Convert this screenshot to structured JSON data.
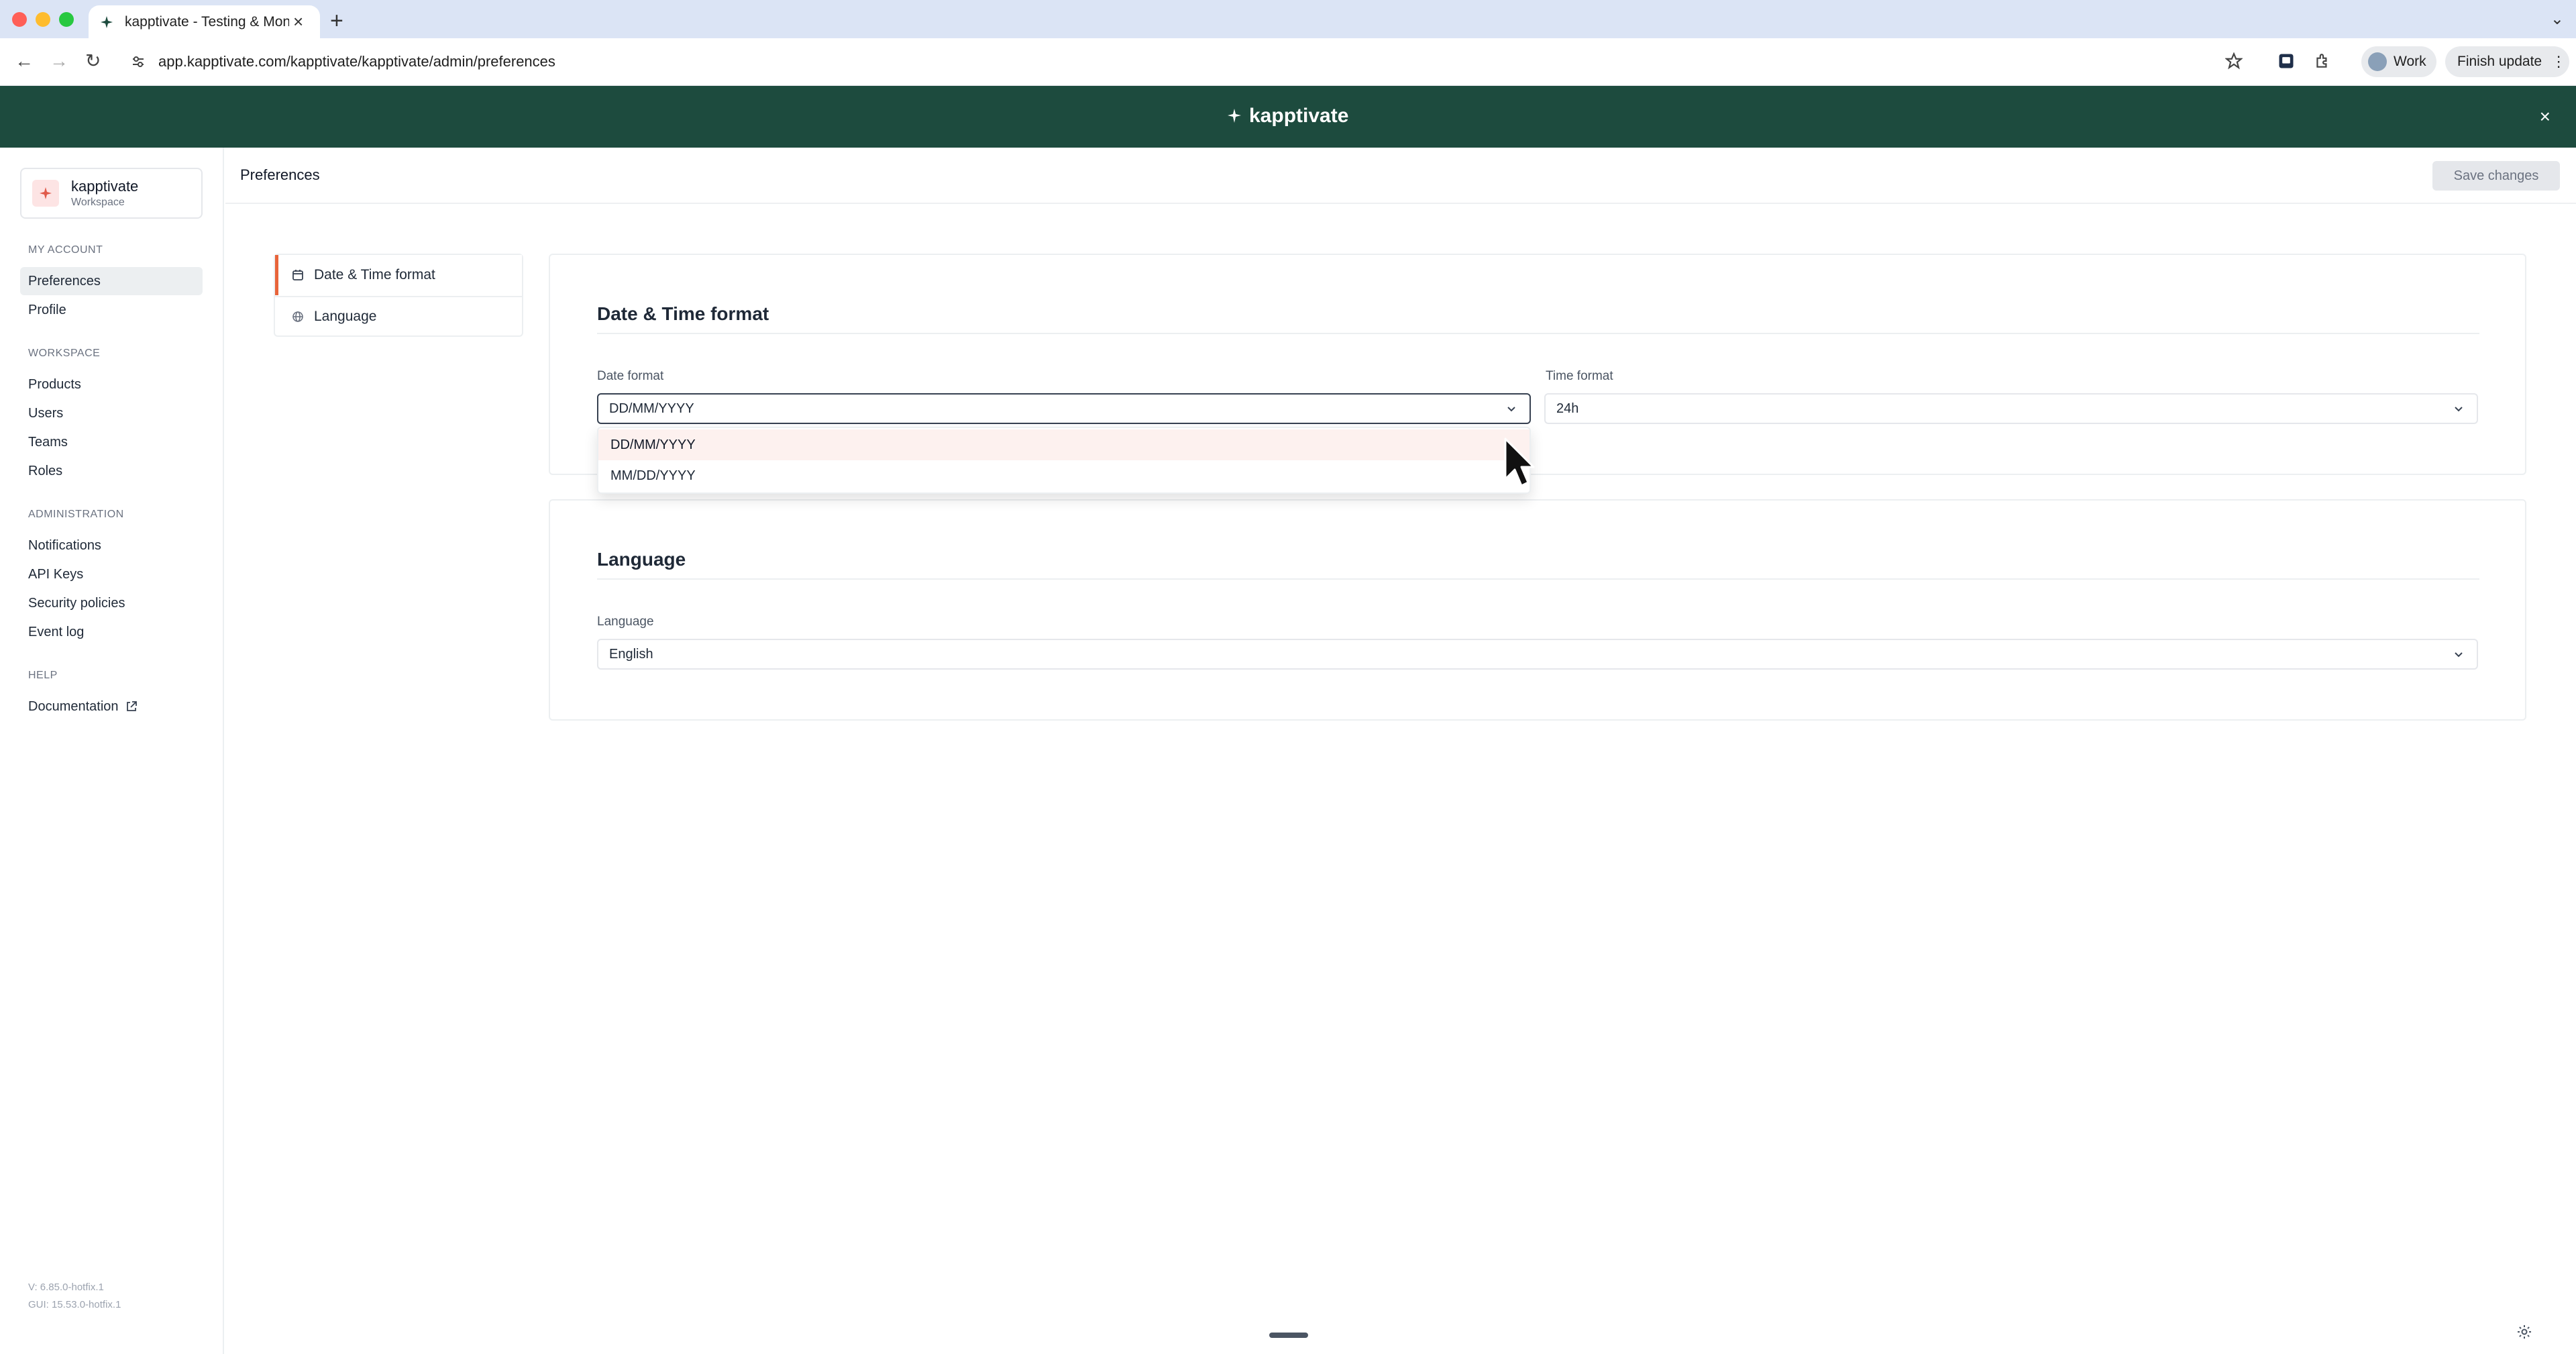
{
  "browser": {
    "tab_title": "kapptivate - Testing & Monitoring",
    "url": "app.kapptivate.com/kapptivate/kapptivate/admin/preferences",
    "profile_label": "Work",
    "finish_update_label": "Finish update"
  },
  "banner": {
    "brand": "kapptivate",
    "close_symbol": "×"
  },
  "sidebar": {
    "workspace_name": "kapptivate",
    "workspace_sub": "Workspace",
    "sections": [
      {
        "label": "MY ACCOUNT",
        "items": [
          {
            "label": "Preferences",
            "active": true
          },
          {
            "label": "Profile"
          }
        ]
      },
      {
        "label": "WORKSPACE",
        "items": [
          {
            "label": "Products"
          },
          {
            "label": "Users"
          },
          {
            "label": "Teams"
          },
          {
            "label": "Roles"
          }
        ]
      },
      {
        "label": "ADMINISTRATION",
        "items": [
          {
            "label": "Notifications"
          },
          {
            "label": "API Keys"
          },
          {
            "label": "Security policies"
          },
          {
            "label": "Event log"
          }
        ]
      },
      {
        "label": "HELP",
        "items": [
          {
            "label": "Documentation"
          }
        ]
      }
    ],
    "version_api": "V: 6.85.0-hotfix.1",
    "version_gui": "GUI: 15.53.0-hotfix.1"
  },
  "header": {
    "title": "Preferences",
    "save_label": "Save changes"
  },
  "subnav": [
    {
      "label": "Date & Time format",
      "icon": "calendar-icon",
      "active": true
    },
    {
      "label": "Language",
      "icon": "globe-icon"
    }
  ],
  "datetime_card": {
    "title": "Date & Time format",
    "date_label": "Date format",
    "date_value": "DD/MM/YYYY",
    "time_label": "Time format",
    "time_value": "24h",
    "date_options": [
      "DD/MM/YYYY",
      "MM/DD/YYYY"
    ]
  },
  "language_card": {
    "title": "Language",
    "language_label": "Language",
    "language_value": "English"
  },
  "colors": {
    "banner": "#1d4b3e",
    "accent": "#e8643a",
    "selected_option_bg": "#fdf1ef"
  }
}
